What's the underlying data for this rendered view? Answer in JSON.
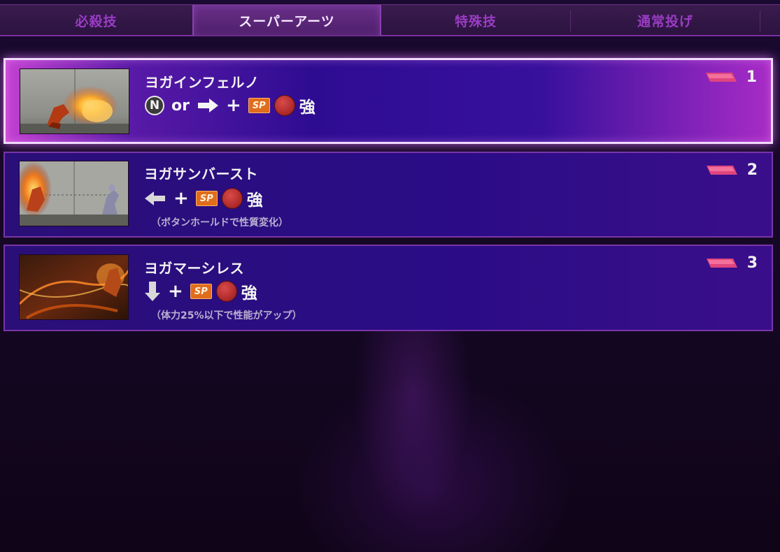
{
  "tabs": [
    {
      "label": "必殺技",
      "active": false
    },
    {
      "label": "スーパーアーツ",
      "active": true
    },
    {
      "label": "特殊技",
      "active": false
    },
    {
      "label": "通常投げ",
      "active": false
    }
  ],
  "moves": [
    {
      "name": "ヨガインフェルノ",
      "neutral_symbol": "N",
      "or_text": "or",
      "plus": "+",
      "sp_label": "SP",
      "strength": "強",
      "level": "1",
      "selected": true,
      "directions": [
        "neutral",
        "forward"
      ]
    },
    {
      "name": "ヨガサンバースト",
      "plus": "+",
      "sp_label": "SP",
      "strength": "強",
      "note": "（ボタンホールドで性質変化）",
      "level": "2",
      "selected": false,
      "directions": [
        "back"
      ]
    },
    {
      "name": "ヨガマーシレス",
      "plus": "+",
      "sp_label": "SP",
      "strength": "強",
      "note": "（体力25%以下で性能がアップ）",
      "level": "3",
      "selected": false,
      "directions": [
        "down"
      ]
    }
  ],
  "colors": {
    "tab_inactive_text": "#9a3cc4",
    "tab_active_text": "#f3e8ff",
    "card_border": "#7a35a8",
    "selected_border": "#f1d9ff",
    "sp_badge": "#e06d1c",
    "button_red": "#b22c2c",
    "meter_pink": "#e0457e"
  },
  "icons": [
    "neutral-icon",
    "arrow-right-icon",
    "arrow-left-icon",
    "arrow-down-icon",
    "sp-badge-icon",
    "heavy-button-icon",
    "super-meter-icon"
  ]
}
